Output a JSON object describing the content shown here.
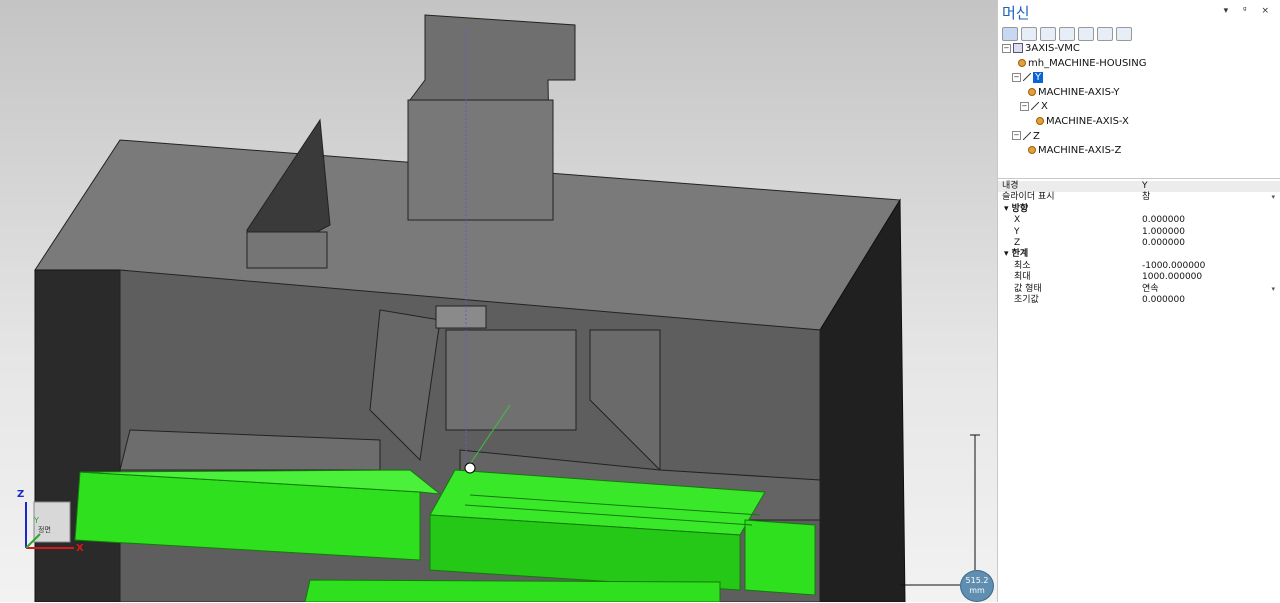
{
  "panel": {
    "title": "머신",
    "controls": "▾ ᵍ ×",
    "toolbar_icons": [
      "select-icon",
      "copy-icon",
      "machine-icon",
      "axis-icon",
      "refresh-icon",
      "properties-icon",
      "search-icon"
    ],
    "tree": [
      {
        "label": "3AXIS-VMC",
        "icon": "root",
        "expander": "⊟"
      },
      {
        "label": "mh_MACHINE-HOUSING",
        "icon": "comp",
        "expander": ""
      },
      {
        "label": "Y",
        "icon": "axis",
        "expander": "⊟",
        "selected": true
      },
      {
        "label": "MACHINE-AXIS-Y",
        "icon": "comp",
        "expander": ""
      },
      {
        "label": "X",
        "icon": "axis",
        "expander": "⊟"
      },
      {
        "label": "MACHINE-AXIS-X",
        "icon": "comp",
        "expander": ""
      },
      {
        "label": "Z",
        "icon": "axis",
        "expander": "⊟"
      },
      {
        "label": "MACHINE-AXIS-Z",
        "icon": "comp",
        "expander": ""
      }
    ],
    "properties": [
      {
        "key": "내경",
        "value": "Y",
        "section": false
      },
      {
        "key": "슬라이더 표시",
        "value": "참",
        "section": false,
        "dropdown": true
      },
      {
        "key": "방향",
        "value": "",
        "section": true
      },
      {
        "key": "X",
        "value": "0.000000",
        "section": false
      },
      {
        "key": "Y",
        "value": "1.000000",
        "section": false
      },
      {
        "key": "Z",
        "value": "0.000000",
        "section": false
      },
      {
        "key": "한계",
        "value": "",
        "section": true
      },
      {
        "key": "최소",
        "value": "-1000.000000",
        "section": false
      },
      {
        "key": "최대",
        "value": "1000.000000",
        "section": false
      },
      {
        "key": "값 형태",
        "value": "연속",
        "section": false,
        "dropdown": true
      },
      {
        "key": "초기값",
        "value": "0.000000",
        "section": false
      }
    ]
  },
  "viewport": {
    "nav_cube_face": "정면",
    "axis_labels": {
      "x": "X",
      "y": "Y",
      "z": "Z"
    },
    "measure": {
      "value": "515.2",
      "unit": "mm"
    }
  },
  "colors": {
    "housing": "#707070",
    "table": "#2ee01e",
    "selection": "#0a64d6",
    "title": "#1e5fbf"
  }
}
